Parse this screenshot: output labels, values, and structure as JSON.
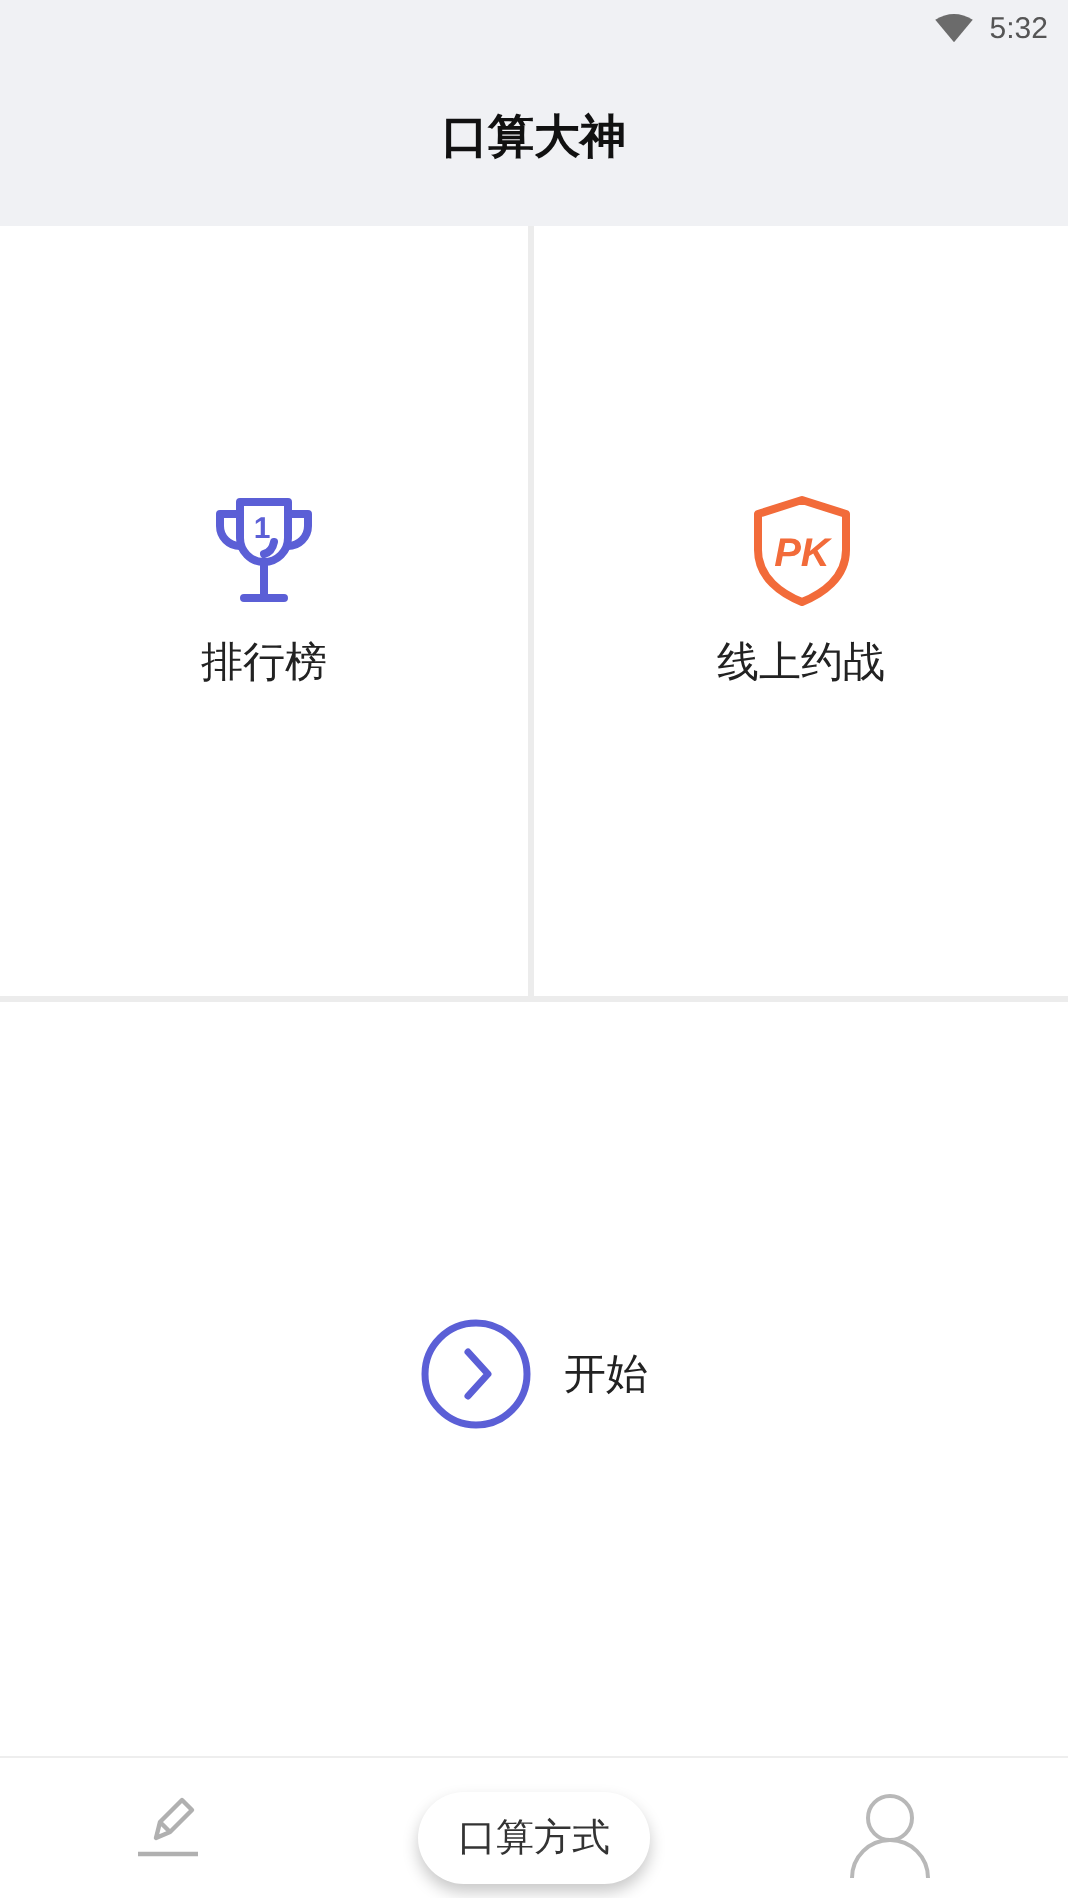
{
  "status_bar": {
    "time": "5:32"
  },
  "header": {
    "title": "口算大神"
  },
  "tiles": [
    {
      "kind": "trophy",
      "label": "排行榜",
      "icon_text": "1",
      "color": "#5b5fd6"
    },
    {
      "kind": "pk",
      "label": "线上约战",
      "icon_text": "PK",
      "color": "#f26b3a"
    }
  ],
  "start": {
    "label": "开始"
  },
  "bottom_nav": [
    {
      "kind": "pencil",
      "selected": false
    },
    {
      "kind": "text",
      "label": "口算方式",
      "selected": true
    },
    {
      "kind": "person",
      "selected": false
    }
  ]
}
